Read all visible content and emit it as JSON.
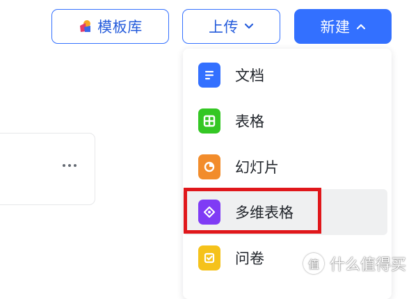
{
  "toolbar": {
    "template_label": "模板库",
    "upload_label": "上传",
    "new_label": "新建"
  },
  "menu": {
    "items": [
      {
        "label": "文档",
        "icon": "doc-icon",
        "color": "#3370ff"
      },
      {
        "label": "表格",
        "icon": "sheet-icon",
        "color": "#34c724"
      },
      {
        "label": "幻灯片",
        "icon": "slides-icon",
        "color": "#f28c2b"
      },
      {
        "label": "多维表格",
        "icon": "base-icon",
        "color": "#7f3bf5"
      },
      {
        "label": "问卷",
        "icon": "form-icon",
        "color": "#f5c21b"
      }
    ]
  },
  "watermark": {
    "text": "什么值得买",
    "logo_char": "值"
  }
}
